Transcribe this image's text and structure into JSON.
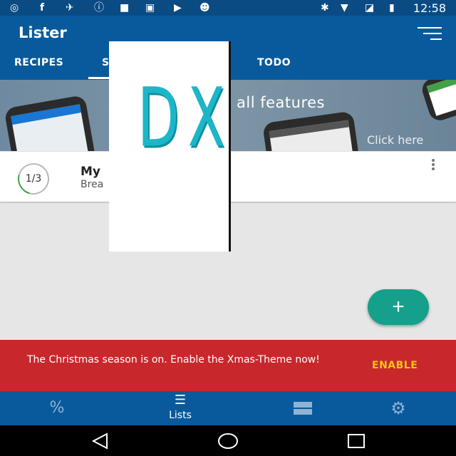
{
  "status_bar": {
    "time": "12:58",
    "icons": [
      "sync-icon",
      "facebook-icon",
      "satellite-icon",
      "info-icon",
      "lock-icon",
      "image-icon",
      "briefcase-icon",
      "android-icon",
      "bluetooth-icon",
      "wifi-icon",
      "no-signal-icon",
      "battery-icon"
    ]
  },
  "app_bar": {
    "title": "Lister",
    "tabs": [
      {
        "label": "RECIPES"
      },
      {
        "label": "S"
      },
      {
        "label": "TODO"
      }
    ]
  },
  "banner": {
    "text": "all features",
    "link": "Click here"
  },
  "list_card": {
    "progress": "1/3",
    "title": "My",
    "subtitle": "Brea"
  },
  "overlay": {
    "glyphs": "DX"
  },
  "fab": {
    "label": "+"
  },
  "snackbar": {
    "message": "The Christmas season is on. Enable the Xmas-Theme now!",
    "action": "ENABLE"
  },
  "bottom_nav": {
    "items": [
      {
        "label": "",
        "icon": "percent-icon"
      },
      {
        "label": "Lists",
        "icon": "list-icon"
      },
      {
        "label": "",
        "icon": "storage-icon"
      },
      {
        "label": "",
        "icon": "gear-icon"
      }
    ]
  }
}
